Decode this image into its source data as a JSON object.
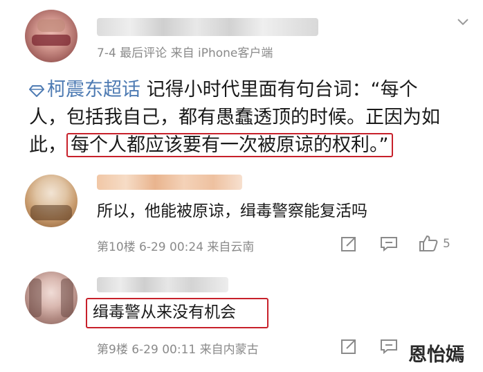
{
  "post": {
    "meta": "7-4 最后评论 来自 iPhone客户端",
    "topic": "柯震东超话",
    "text_part1": "记得小时代里面有句台词：“每个",
    "text_line2": "人，包括我自己，都有愚蠢透顶的时候。正因为如",
    "text_line3_prefix": "此，",
    "text_highlight": "每个人都应该要有一次被原谅的权利。”"
  },
  "comments": [
    {
      "text": "所以，他能被原谅，缉毒警察能复活吗",
      "meta": "第10楼 6-29 00:24 来自云南",
      "like_count": "5"
    },
    {
      "text": "缉毒警从来没有机会",
      "meta": "第9楼 6-29 00:11 来自内蒙古"
    }
  ],
  "watermark": "恩怡嫣",
  "icons": {
    "chevron": "chevron-down-icon",
    "topic": "diamond-icon",
    "edit": "edit-icon",
    "comment": "comment-icon",
    "like": "thumbs-up-icon"
  }
}
